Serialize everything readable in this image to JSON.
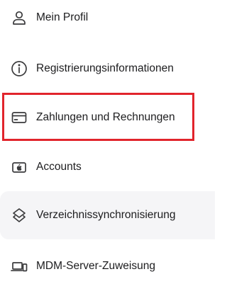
{
  "menu": {
    "items": [
      {
        "label": "Mein Profil",
        "icon": "person-icon"
      },
      {
        "label": "Registrierungsinformationen",
        "icon": "info-circle-icon"
      },
      {
        "label": "Zahlungen und Rechnungen",
        "icon": "credit-card-icon",
        "highlighted": true
      },
      {
        "label": "Accounts",
        "icon": "apple-account-icon"
      },
      {
        "label": "Verzeichnissynchronisierung",
        "icon": "layers-sync-icon",
        "hovered": true
      },
      {
        "label": "MDM-Server-Zuweisung",
        "icon": "laptop-phone-icon"
      }
    ]
  },
  "colors": {
    "highlight_border": "#e1242c",
    "hover_background": "#f5f5f7",
    "text": "#1d1d1f",
    "icon": "#3a3a3c"
  }
}
